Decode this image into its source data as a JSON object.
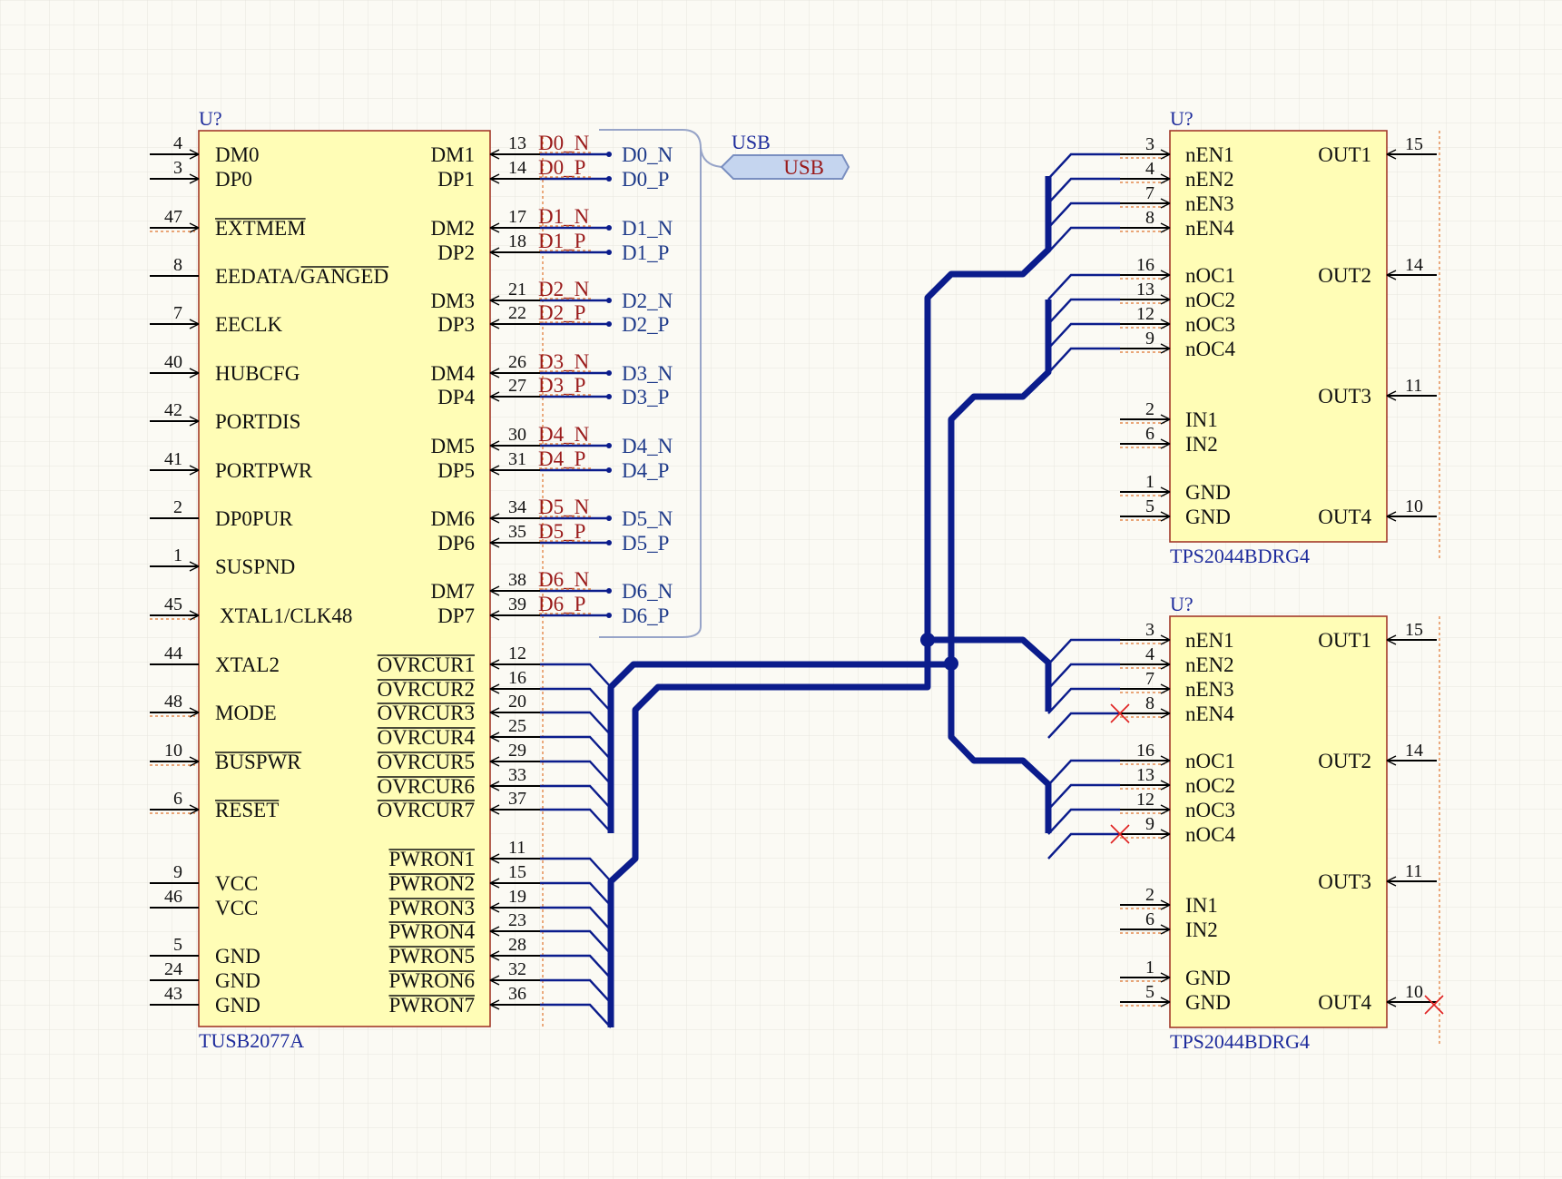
{
  "colors": {
    "background": "#fbfaf4",
    "grid": "#e7e5de",
    "component_fill": "#fffdb6",
    "component_border": "#a33a2a",
    "wire": "#0b1c8c",
    "net_label": "#9a1b1b",
    "designator": "#1e2c9c",
    "error_marker": "#e02020"
  },
  "hub": {
    "designator": "U?",
    "part": "TUSB2077A",
    "left_pins": [
      {
        "num": "4",
        "name": "DM0"
      },
      {
        "num": "3",
        "name": "DP0"
      },
      {
        "num": "47",
        "name": "EXTMEM"
      },
      {
        "num": "8",
        "name": "EEDATA/GANGED"
      },
      {
        "num": "7",
        "name": "EECLK"
      },
      {
        "num": "40",
        "name": "HUBCFG"
      },
      {
        "num": "42",
        "name": "PORTDIS"
      },
      {
        "num": "41",
        "name": "PORTPWR"
      },
      {
        "num": "2",
        "name": "DP0PUR"
      },
      {
        "num": "1",
        "name": "SUSPND"
      },
      {
        "num": "45",
        "name": "XTAL1/CLK48"
      },
      {
        "num": "44",
        "name": "XTAL2"
      },
      {
        "num": "48",
        "name": "MODE"
      },
      {
        "num": "10",
        "name": "BUSPWR"
      },
      {
        "num": "6",
        "name": "RESET"
      },
      {
        "num": "9",
        "name": "VCC"
      },
      {
        "num": "46",
        "name": "VCC"
      },
      {
        "num": "5",
        "name": "GND"
      },
      {
        "num": "24",
        "name": "GND"
      },
      {
        "num": "43",
        "name": "GND"
      }
    ],
    "right_pins": [
      {
        "num": "13",
        "name": "DM1"
      },
      {
        "num": "14",
        "name": "DP1"
      },
      {
        "num": "17",
        "name": "DM2"
      },
      {
        "num": "18",
        "name": "DP2"
      },
      {
        "num": "21",
        "name": "DM3"
      },
      {
        "num": "22",
        "name": "DP3"
      },
      {
        "num": "26",
        "name": "DM4"
      },
      {
        "num": "27",
        "name": "DP4"
      },
      {
        "num": "30",
        "name": "DM5"
      },
      {
        "num": "31",
        "name": "DP5"
      },
      {
        "num": "34",
        "name": "DM6"
      },
      {
        "num": "35",
        "name": "DP6"
      },
      {
        "num": "38",
        "name": "DM7"
      },
      {
        "num": "39",
        "name": "DP7"
      },
      {
        "num": "12",
        "name": "OVRCUR1"
      },
      {
        "num": "16",
        "name": "OVRCUR2"
      },
      {
        "num": "20",
        "name": "OVRCUR3"
      },
      {
        "num": "25",
        "name": "OVRCUR4"
      },
      {
        "num": "29",
        "name": "OVRCUR5"
      },
      {
        "num": "33",
        "name": "OVRCUR6"
      },
      {
        "num": "37",
        "name": "OVRCUR7"
      },
      {
        "num": "11",
        "name": "PWRON1"
      },
      {
        "num": "15",
        "name": "PWRON2"
      },
      {
        "num": "19",
        "name": "PWRON3"
      },
      {
        "num": "23",
        "name": "PWRON4"
      },
      {
        "num": "28",
        "name": "PWRON5"
      },
      {
        "num": "32",
        "name": "PWRON6"
      },
      {
        "num": "36",
        "name": "PWRON7"
      }
    ],
    "net_labels": [
      "D0_N",
      "D0_P",
      "D1_N",
      "D1_P",
      "D2_N",
      "D2_P",
      "D3_N",
      "D3_P",
      "D4_N",
      "D4_P",
      "D5_N",
      "D5_P",
      "D6_N",
      "D6_P"
    ],
    "harness_entries": [
      "D0_N",
      "D0_P",
      "D1_N",
      "D1_P",
      "D2_N",
      "D2_P",
      "D3_N",
      "D3_P",
      "D4_N",
      "D4_P",
      "D5_N",
      "D5_P",
      "D6_N",
      "D6_P"
    ]
  },
  "harness": {
    "label": "USB",
    "port": "USB"
  },
  "switches": [
    {
      "designator": "U?",
      "part": "TPS2044BDRG4",
      "left_pins": [
        {
          "num": "3",
          "name": "nEN1"
        },
        {
          "num": "4",
          "name": "nEN2"
        },
        {
          "num": "7",
          "name": "nEN3"
        },
        {
          "num": "8",
          "name": "nEN4"
        },
        {
          "num": "16",
          "name": "nOC1"
        },
        {
          "num": "13",
          "name": "nOC2"
        },
        {
          "num": "12",
          "name": "nOC3"
        },
        {
          "num": "9",
          "name": "nOC4"
        },
        {
          "num": "2",
          "name": "IN1"
        },
        {
          "num": "6",
          "name": "IN2"
        },
        {
          "num": "1",
          "name": "GND"
        },
        {
          "num": "5",
          "name": "GND"
        }
      ],
      "right_pins": [
        {
          "num": "15",
          "name": "OUT1"
        },
        {
          "num": "14",
          "name": "OUT2"
        },
        {
          "num": "11",
          "name": "OUT3"
        },
        {
          "num": "10",
          "name": "OUT4"
        }
      ]
    },
    {
      "designator": "U?",
      "part": "TPS2044BDRG4",
      "left_pins": [
        {
          "num": "3",
          "name": "nEN1"
        },
        {
          "num": "4",
          "name": "nEN2"
        },
        {
          "num": "7",
          "name": "nEN3"
        },
        {
          "num": "8",
          "name": "nEN4"
        },
        {
          "num": "16",
          "name": "nOC1"
        },
        {
          "num": "13",
          "name": "nOC2"
        },
        {
          "num": "12",
          "name": "nOC3"
        },
        {
          "num": "9",
          "name": "nOC4"
        },
        {
          "num": "2",
          "name": "IN1"
        },
        {
          "num": "6",
          "name": "IN2"
        },
        {
          "num": "1",
          "name": "GND"
        },
        {
          "num": "5",
          "name": "GND"
        }
      ],
      "right_pins": [
        {
          "num": "15",
          "name": "OUT1"
        },
        {
          "num": "14",
          "name": "OUT2"
        },
        {
          "num": "11",
          "name": "OUT3"
        },
        {
          "num": "10",
          "name": "OUT4"
        }
      ]
    }
  ]
}
